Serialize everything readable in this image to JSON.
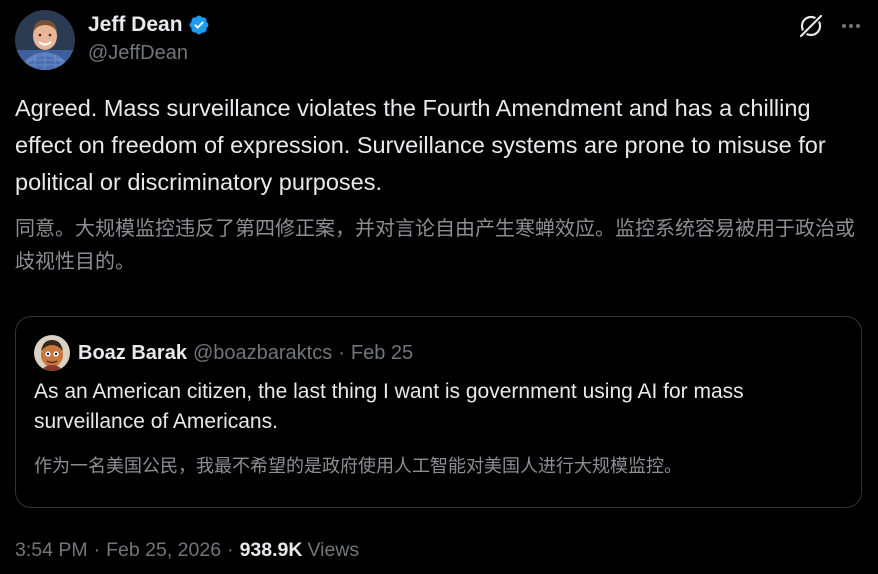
{
  "author": {
    "display_name": "Jeff Dean",
    "handle": "@JeffDean",
    "verified_icon": "verified-badge-icon",
    "avatar_icon": "avatar"
  },
  "actions": {
    "grok_icon": "grok-icon",
    "more_icon": "more-icon"
  },
  "tweet": {
    "text": "Agreed.  Mass surveillance violates the Fourth Amendment and has a chilling effect on freedom of expression. Surveillance systems are prone to misuse for political or discriminatory purposes.",
    "translation": "同意。大规模监控违反了第四修正案，并对言论自由产生寒蝉效应。监控系统容易被用于政治或歧视性目的。"
  },
  "quote": {
    "display_name": "Boaz Barak",
    "handle": "@boazbaraktcs",
    "separator": "·",
    "date": "Feb 25",
    "text": "As an American citizen, the last thing I want is government using AI for mass surveillance of Americans.",
    "translation": "作为一名美国公民，我最不希望的是政府使用人工智能对美国人进行大规模监控。"
  },
  "meta": {
    "time": "3:54 PM",
    "separator": "·",
    "date": "Feb 25, 2026",
    "views_count": "938.9K",
    "views_label": "Views"
  },
  "colors": {
    "background": "#000000",
    "primary_text": "#e7e9ea",
    "secondary_text": "#71767b",
    "translation_text": "#8b8f93",
    "border": "#2f3336",
    "verified_blue": "#1d9bf0"
  }
}
